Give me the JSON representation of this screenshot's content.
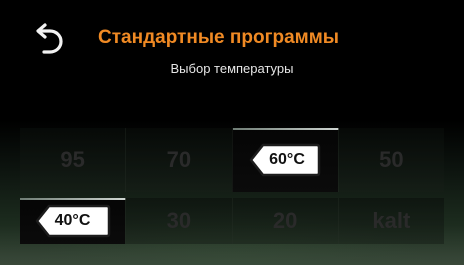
{
  "header": {
    "back_icon": "back-arrow-icon",
    "title": "Стандартные программы",
    "subtitle": "Выбор температуры"
  },
  "colors": {
    "title": "#f08a24",
    "subtitle": "#e6e6e6",
    "inactive_value": "#2a2a2a",
    "selected_tag": "#ffffff",
    "selected_tag_border": "#222222"
  },
  "temperatures": {
    "row1": [
      {
        "label": "95",
        "selected": false
      },
      {
        "label": "70",
        "selected": false
      },
      {
        "label": "60°C",
        "selected": true
      },
      {
        "label": "50",
        "selected": false
      }
    ],
    "row2": [
      {
        "label": "40°C",
        "selected": true
      },
      {
        "label": "30",
        "selected": false
      },
      {
        "label": "20",
        "selected": false
      },
      {
        "label": "kalt",
        "selected": false
      }
    ]
  }
}
